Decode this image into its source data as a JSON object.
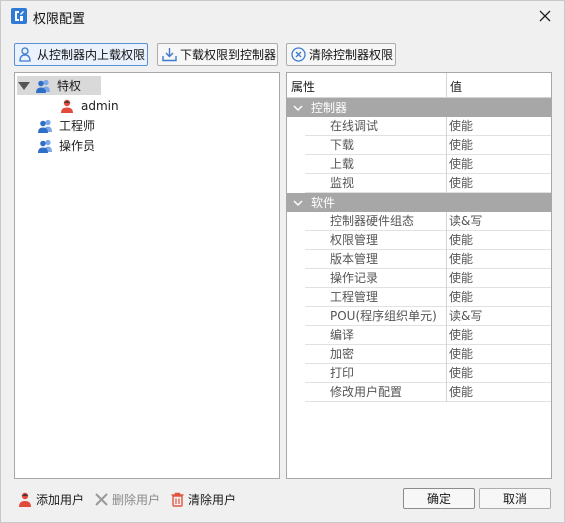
{
  "window": {
    "title": "权限配置",
    "icon": "app-logo-icon",
    "close_icon": "close-icon"
  },
  "toolbar": {
    "upload_label": "从控制器内上载权限",
    "download_label": "下载权限到控制器",
    "clear_label": "清除控制器权限"
  },
  "tree": {
    "items": [
      {
        "label": "特权",
        "icon": "user-group-icon",
        "expanded": true,
        "selected": true
      },
      {
        "label": "admin",
        "icon": "user-icon",
        "level": 1
      },
      {
        "label": "工程师",
        "icon": "user-group-icon"
      },
      {
        "label": "操作员",
        "icon": "user-group-icon"
      }
    ]
  },
  "properties": {
    "header": {
      "name": "属性",
      "value": "值"
    },
    "categories": [
      {
        "label": "控制器",
        "rows": [
          {
            "name": "在线调试",
            "value": "使能"
          },
          {
            "name": "下载",
            "value": "使能"
          },
          {
            "name": "上载",
            "value": "使能"
          },
          {
            "name": "监视",
            "value": "使能"
          }
        ]
      },
      {
        "label": "软件",
        "rows": [
          {
            "name": "控制器硬件组态",
            "value": "读&写"
          },
          {
            "name": "权限管理",
            "value": "使能"
          },
          {
            "name": "版本管理",
            "value": "使能"
          },
          {
            "name": "操作记录",
            "value": "使能"
          },
          {
            "name": "工程管理",
            "value": "使能"
          },
          {
            "name": "POU(程序组织单元)",
            "value": "读&写"
          },
          {
            "name": "编译",
            "value": "使能"
          },
          {
            "name": "加密",
            "value": "使能"
          },
          {
            "name": "打印",
            "value": "使能"
          },
          {
            "name": "修改用户配置",
            "value": "使能"
          }
        ]
      }
    ]
  },
  "bottom": {
    "add_user": "添加用户",
    "delete_user": "删除用户",
    "clear_users": "清除用户",
    "ok": "确定",
    "cancel": "取消"
  },
  "colors": {
    "category_bg": "#a7a7a7",
    "selection_bg": "#d9d9d9",
    "accent": "#2f7ad6"
  }
}
